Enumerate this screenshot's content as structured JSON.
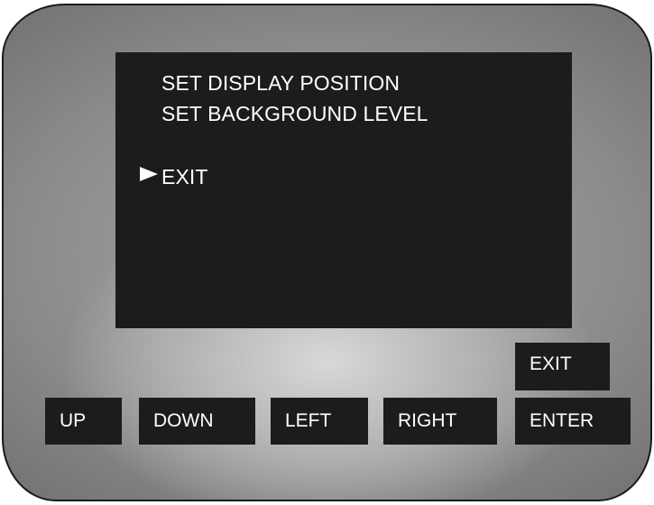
{
  "screen": {
    "menu_items": [
      {
        "label": "SET DISPLAY POSITION"
      },
      {
        "label": "SET BACKGROUND LEVEL"
      },
      {
        "label": "EXIT",
        "selected": true
      }
    ],
    "cursor_icon": "play-triangle-right"
  },
  "buttons": {
    "exit": "EXIT",
    "up": "UP",
    "down": "DOWN",
    "left": "LEFT",
    "right": "RIGHT",
    "enter": "ENTER"
  },
  "colors": {
    "screen_bg": "#1c1c1c",
    "text": "#ffffff",
    "bezel": "#8a8a8a"
  }
}
